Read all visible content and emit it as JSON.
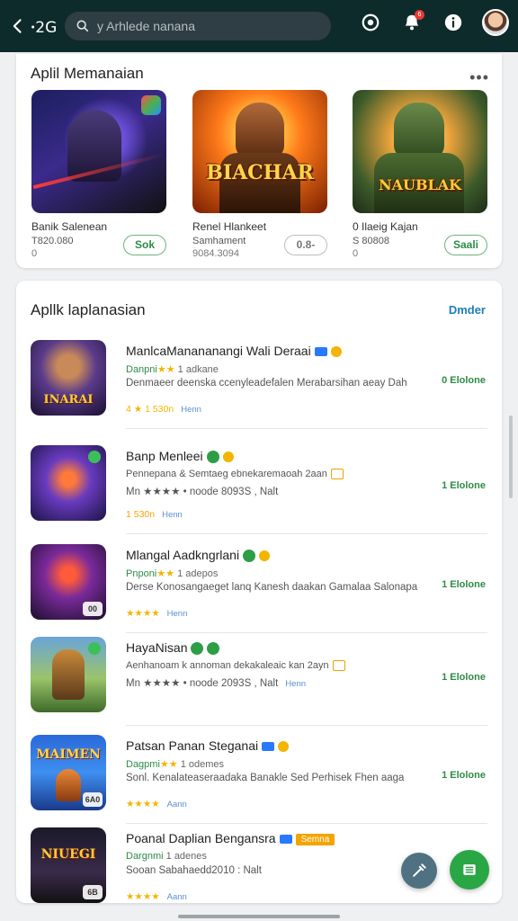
{
  "topbar": {
    "back_label": "ꞏ2G",
    "search_placeholder": "y Arhlede nanana",
    "notif_count": "6",
    "icons": [
      "back-arrow-icon",
      "search-icon",
      "gamepad-icon",
      "notification-bell-icon",
      "info-icon",
      "avatar"
    ]
  },
  "featured": {
    "title": "Aplil Memanaian",
    "items": [
      {
        "name": "Banik Salenean",
        "meta": "T820.080",
        "sub": "0",
        "button": "Sok",
        "art_text": ""
      },
      {
        "name": "Renel Hlankeet",
        "meta": "Samhament",
        "sub": "9084.3094",
        "button": "0.8-",
        "art_text": "BIACHAR"
      },
      {
        "name": "0 Ilaeig Kajan",
        "meta": "S 80808",
        "sub": "0",
        "button": "Saali",
        "art_text": "NAUBLAK"
      }
    ]
  },
  "list_section": {
    "title": "Apllk laplanasian",
    "see_all": "Dmder",
    "rows": [
      {
        "title": "ManlcaManananangi Wali Deraai",
        "developer": "Danpni",
        "stars": "★★",
        "count": "1 adkane",
        "desc": "Denmaeer deenska ccenyleadefalen Merabarsihan aeay Dah",
        "rating_line": "4 ★ 1 530n",
        "link": "Henn",
        "action": "0 Elolone",
        "corner": ""
      },
      {
        "title": "Banp Menleei",
        "developer": "Pannepana",
        "stars": "",
        "count": "& Semtaeg",
        "desc": "Pennepana & Semtaeg ebnekaremaoah 2aan",
        "rating_line": "Mn ★★★★ • noode 8093S , Nalt",
        "link": "",
        "action": "1 Elolone",
        "corner": "",
        "line4": "1 530n",
        "line4_link": "Henn"
      },
      {
        "title": "Mlangal Aadkngrlani",
        "developer": "Pnponi",
        "stars": "★★",
        "count": "1 adepos",
        "desc": "Derse Konosangaeget lanq Kanesh daakan Gamalaa Salonapa",
        "rating_line": "★★★★",
        "link": "Henn",
        "action": "1 Elolone",
        "corner": "00"
      },
      {
        "title": "HayaNisan",
        "developer": "Aenhanoam",
        "stars": "",
        "count": "",
        "desc": "Aenhanoam k annoman dekakaleaic kan 2ayn",
        "rating_line": "Mn ★★★★ • noode 2093S , Nalt",
        "link": "Henn",
        "action": "1 Elolone",
        "corner": ""
      },
      {
        "title": "Patsan Panan Steganai",
        "developer": "Dagpmi",
        "stars": "★★",
        "count": "1 odemes",
        "desc": "Sonl. Kenalateaseraadaka Banakle Sed Perhisek Fhen aaga",
        "rating_line": "★★★★",
        "link": "Aann",
        "action": "1 Elolone",
        "corner": "6A0"
      },
      {
        "title": "Poanal Daplian Bengansra",
        "developer": "Dargnmi",
        "stars": "",
        "count": "1 adenes",
        "desc": "Sooan Sabahaedd2010 : Nalt",
        "rating_line": "★★★★",
        "link": "Aann",
        "action": "",
        "corner": "6B",
        "label_badge": "Semna"
      }
    ]
  },
  "colors": {
    "topbar": "#0e2b2b",
    "accent_green": "#2e8b46",
    "link_blue": "#1e7fb8",
    "star": "#f4b400"
  }
}
